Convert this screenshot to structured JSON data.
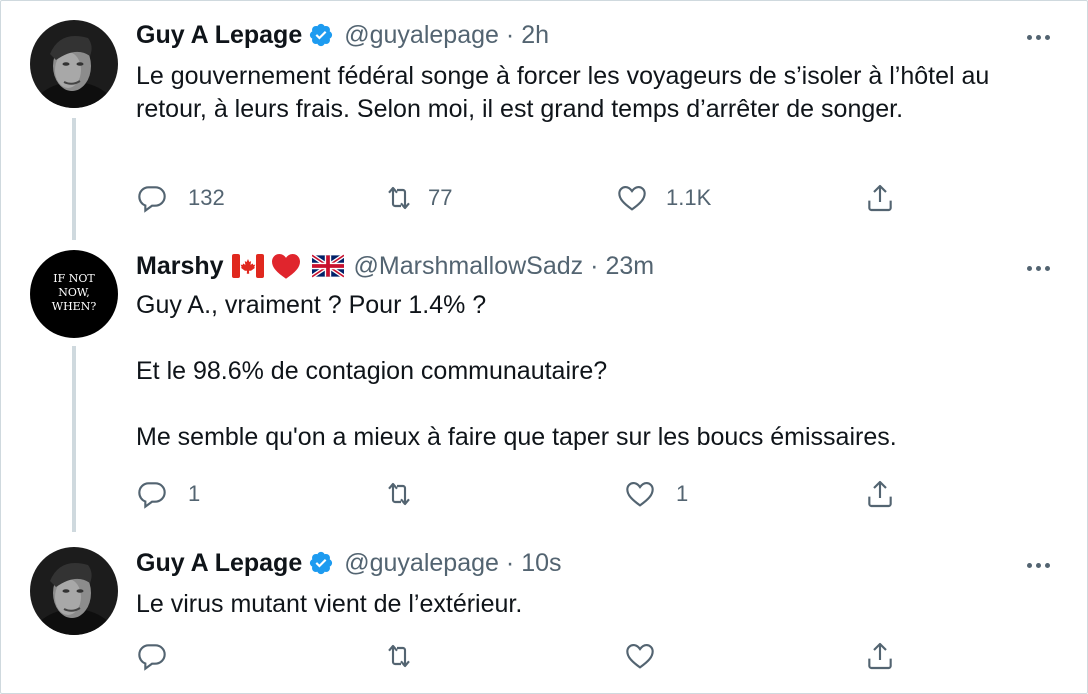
{
  "tweets": [
    {
      "author": {
        "name": "Guy A Lepage",
        "handle": "@guyalepage",
        "verified": true,
        "avatar": "portrait-photo"
      },
      "separator": "·",
      "time": "2h",
      "text": "Le gouvernement fédéral songe à forcer les voyageurs de s’isoler à l’hôtel au retour, à leurs frais. Selon moi, il est grand temps d’arrêter de songer.",
      "stats": {
        "replies": "132",
        "retweets": "77",
        "likes": "1.1K"
      }
    },
    {
      "author": {
        "name": "Marshy",
        "handle": "@MarshmallowSadz",
        "verified": false,
        "emoji": [
          "canada-flag",
          "red-heart",
          "uk-flag"
        ],
        "avatar": "black-circle-text",
        "avatar_text": [
          "IF NOT",
          "NOW,",
          "WHEN?"
        ]
      },
      "separator": "·",
      "time": "23m",
      "text": "Guy A., vraiment ? Pour 1.4% ?\n\nEt le 98.6% de contagion communautaire?\n\nMe semble qu'on a mieux à faire que taper sur les boucs émissaires.",
      "stats": {
        "replies": "1",
        "retweets": "",
        "likes": "1"
      }
    },
    {
      "author": {
        "name": "Guy A Lepage",
        "handle": "@guyalepage",
        "verified": true,
        "avatar": "portrait-photo"
      },
      "separator": "·",
      "time": "10s",
      "text": "Le virus mutant vient de l’extérieur.",
      "stats": {
        "replies": "",
        "retweets": "",
        "likes": ""
      }
    }
  ],
  "icons": {
    "reply": "reply-icon",
    "retweet": "retweet-icon",
    "like": "heart-icon",
    "share": "share-icon",
    "more": "more-icon",
    "verified": "verified-badge-icon"
  },
  "colors": {
    "text": "#0f1419",
    "secondary": "#536471",
    "verified": "#1d9bf0",
    "thread_line": "#cfd9de"
  }
}
